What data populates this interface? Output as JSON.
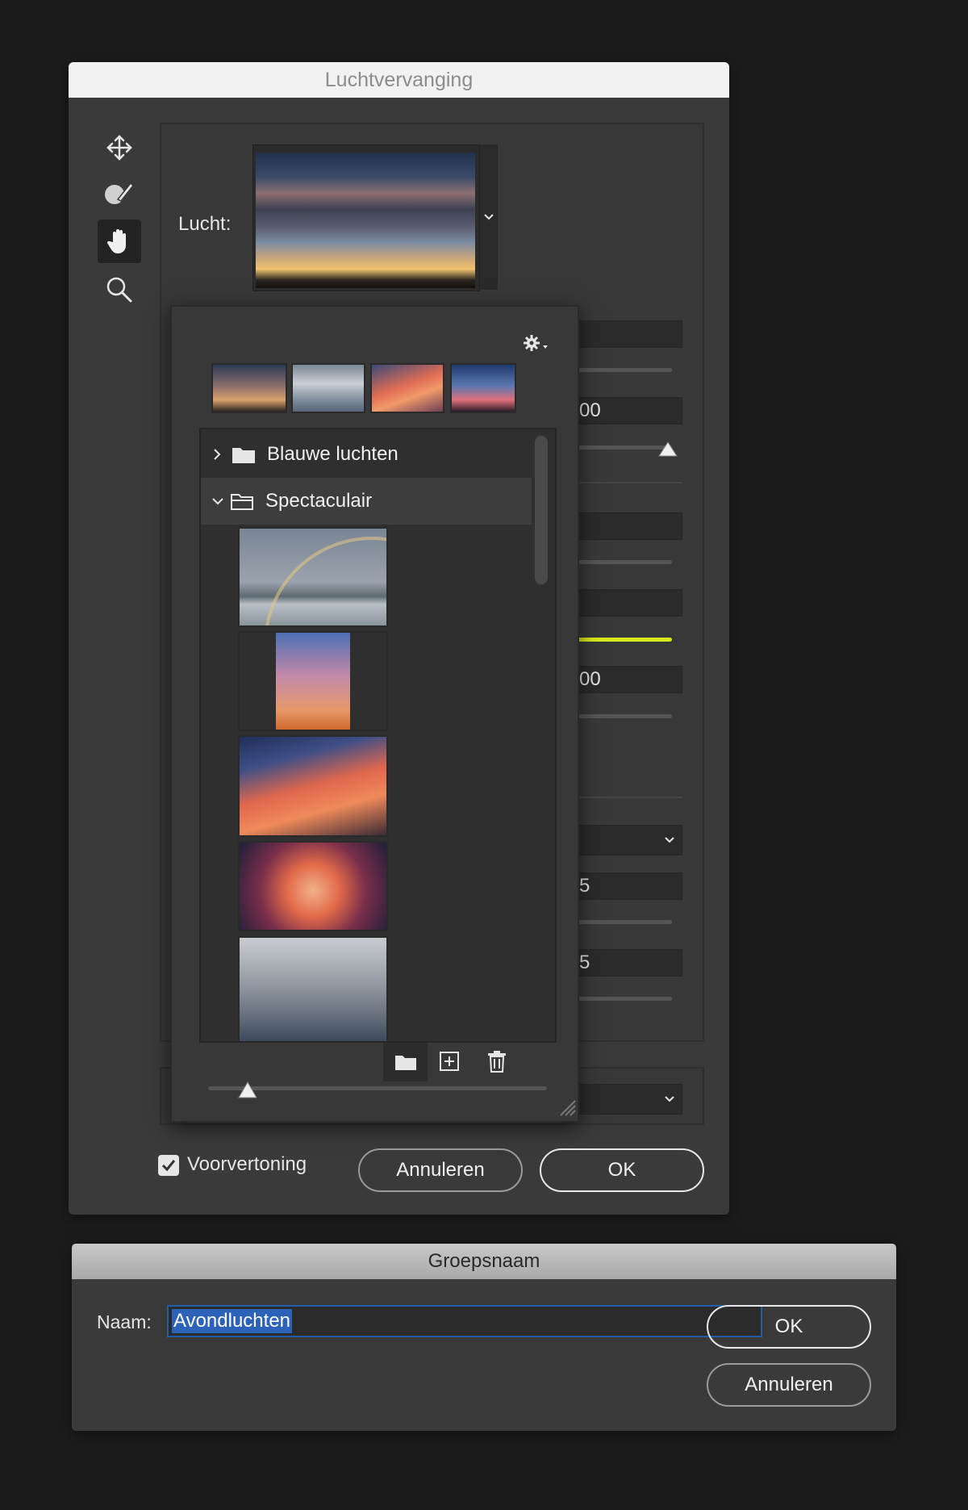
{
  "main_dialog": {
    "title": "Luchtvervanging",
    "sky_label": "Lucht:",
    "fields": [
      "00",
      "00",
      "5",
      "5"
    ],
    "preview_label": "Voorvertoning",
    "preview_checked": true,
    "cancel_label": "Annuleren",
    "ok_label": "OK"
  },
  "tools": [
    "move-icon",
    "sky-brush-icon",
    "hand-icon",
    "zoom-icon"
  ],
  "sky_preset_popup": {
    "recent_thumbnails": 4,
    "folders": [
      {
        "label": "Blauwe luchten",
        "expanded": false
      },
      {
        "label": "Spectaculair",
        "expanded": true
      }
    ],
    "footer_icons": [
      "new-folder-icon",
      "add-sky-icon",
      "trash-icon"
    ]
  },
  "group_name_dialog": {
    "title": "Groepsnaam",
    "name_label": "Naam:",
    "name_value": "Avondluchten",
    "ok_label": "OK",
    "cancel_label": "Annuleren"
  },
  "colors": {
    "accent_yellow": "#d8e81a",
    "selection_blue": "#2c62b8"
  }
}
